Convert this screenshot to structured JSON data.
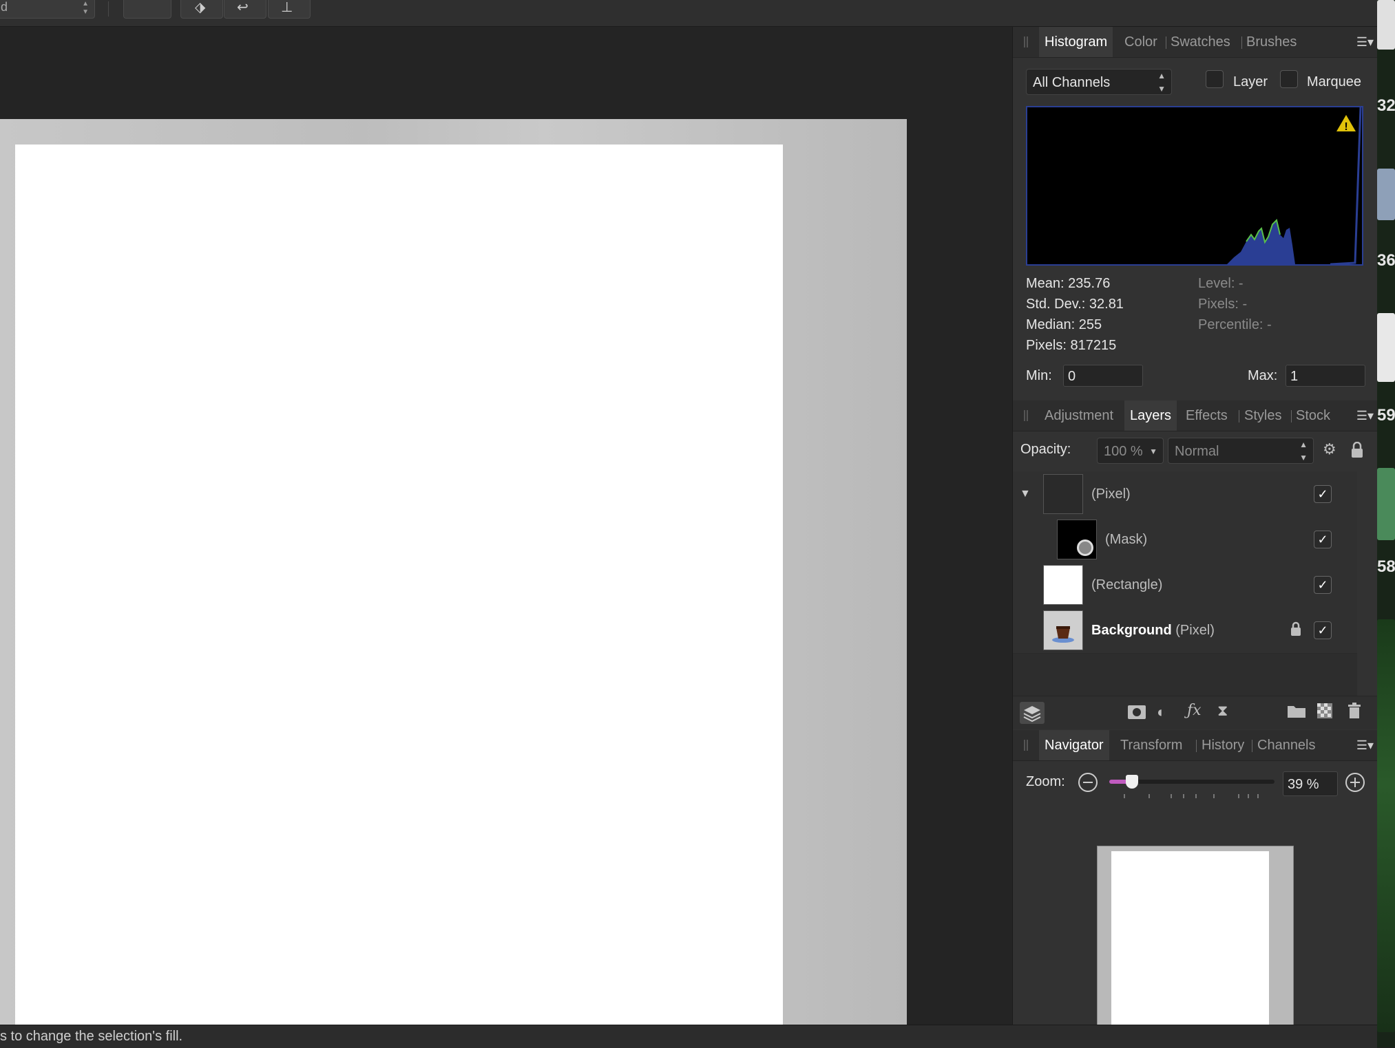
{
  "toolbar": {
    "select_value": "d"
  },
  "status": {
    "text": "s to change the selection's fill."
  },
  "histogram_panel": {
    "tabs": [
      "Histogram",
      "Color",
      "Swatches",
      "Brushes"
    ],
    "active_tab": "Histogram",
    "channel_select": "All Channels",
    "layer_label": "Layer",
    "marquee_label": "Marquee",
    "warning_icon": "warning-triangle-icon",
    "stats": {
      "mean": "Mean: 235.76",
      "std_dev": "Std. Dev.: 32.81",
      "median": "Median: 255",
      "pixels": "Pixels: 817215",
      "level": "Level: -",
      "pixels_sel": "Pixels: -",
      "percentile": "Percentile: -"
    },
    "min_label": "Min:",
    "min_value": "0",
    "max_label": "Max:",
    "max_value": "1",
    "colors": {
      "background": "#000000",
      "fill": "#2a3e94",
      "peak": "#59c04a",
      "border": "#2a3e94"
    }
  },
  "layers_panel": {
    "tabs": [
      "Adjustment",
      "Layers",
      "Effects",
      "Styles",
      "Stock"
    ],
    "active_tab": "Layers",
    "opacity_label": "Opacity:",
    "opacity_value": "100 %",
    "blend_mode": "Normal",
    "layers": [
      {
        "name": "(Pixel)",
        "visible": true
      },
      {
        "name": "(Mask)",
        "visible": true
      },
      {
        "name": "(Rectangle)",
        "visible": true
      },
      {
        "name": "Background",
        "type": "(Pixel)",
        "visible": true,
        "locked": true
      }
    ],
    "check_glyph": "✓"
  },
  "navigator_panel": {
    "tabs": [
      "Navigator",
      "Transform",
      "History",
      "Channels"
    ],
    "active_tab": "Navigator",
    "zoom_label": "Zoom:",
    "zoom_value": "39 %",
    "zoom_level": 0.1,
    "slider_color": "#c05bbf"
  },
  "right_strip": {
    "numbers": [
      "32.",
      "36",
      "59",
      "58"
    ]
  }
}
